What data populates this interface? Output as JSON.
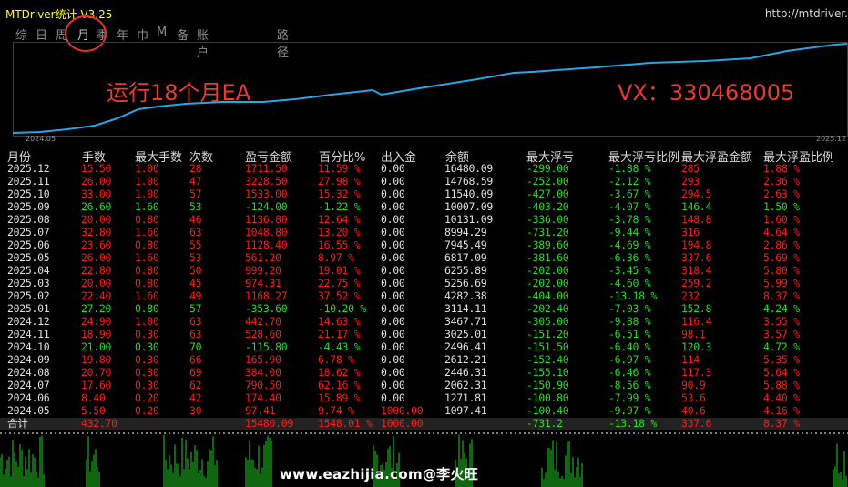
{
  "title": "MTDriver统计  V3.25",
  "url": "http://mtdriver.",
  "tabs": [
    "综",
    "日",
    "周",
    "月",
    "季",
    "年",
    "巾",
    "M",
    "备",
    "账户",
    "路径"
  ],
  "annotation_left": "运行18个月EA",
  "annotation_right": "VX：330468005",
  "date_start": "2024.05",
  "date_end": "2025.12",
  "headers": [
    "月份",
    "手数",
    "最大手数",
    "次数",
    "盈亏金额",
    "百分比%",
    "出入金",
    "余额",
    "最大浮亏",
    "最大浮亏比例",
    "最大浮盈金额",
    "最大浮盈比例"
  ],
  "rows": [
    [
      "2025.12",
      "15.50",
      "1.00",
      "28",
      "1711.50",
      "11.59 %",
      "0.00",
      "16480.09",
      "-299.00",
      "-1.88 %",
      "285",
      "1.88 %"
    ],
    [
      "2025.11",
      "26.00",
      "1.00",
      "47",
      "3228.50",
      "27.98 %",
      "0.00",
      "14768.59",
      "-252.00",
      "-2.12 %",
      "293",
      "2.36 %"
    ],
    [
      "2025.10",
      "33.00",
      "1.00",
      "57",
      "1533.00",
      "15.32 %",
      "0.00",
      "11540.09",
      "-427.00",
      "-3.67 %",
      "294.5",
      "2.63 %"
    ],
    [
      "2025.09",
      "26.60",
      "1.60",
      "53",
      "-124.00",
      "-1.22 %",
      "0.00",
      "10007.09",
      "-403.20",
      "-4.07 %",
      "146.4",
      "1.50 %"
    ],
    [
      "2025.08",
      "20.00",
      "0.80",
      "46",
      "1136.80",
      "12.64 %",
      "0.00",
      "10131.09",
      "-336.00",
      "-3.78 %",
      "148.8",
      "1.60 %"
    ],
    [
      "2025.07",
      "32.80",
      "1.60",
      "63",
      "1048.80",
      "13.20 %",
      "0.00",
      "8994.29",
      "-731.20",
      "-9.44 %",
      "316",
      "4.64 %"
    ],
    [
      "2025.06",
      "23.60",
      "0.80",
      "55",
      "1128.40",
      "16.55 %",
      "0.00",
      "7945.49",
      "-389.60",
      "-4.69 %",
      "194.8",
      "2.86 %"
    ],
    [
      "2025.05",
      "26.00",
      "1.60",
      "53",
      "561.20",
      "8.97 %",
      "0.00",
      "6817.09",
      "-381.60",
      "-6.36 %",
      "337.6",
      "5.69 %"
    ],
    [
      "2025.04",
      "22.80",
      "0.80",
      "50",
      "999.20",
      "19.01 %",
      "0.00",
      "6255.89",
      "-202.00",
      "-3.45 %",
      "318.4",
      "5.80 %"
    ],
    [
      "2025.03",
      "20.00",
      "0.80",
      "45",
      "974.31",
      "22.75 %",
      "0.00",
      "5256.69",
      "-202.00",
      "-4.60 %",
      "259.2",
      "5.99 %"
    ],
    [
      "2025.02",
      "22.40",
      "1.60",
      "49",
      "1168.27",
      "37.52 %",
      "0.00",
      "4282.38",
      "-404.00",
      "-13.18 %",
      "232",
      "8.37 %"
    ],
    [
      "2025.01",
      "27.20",
      "0.80",
      "57",
      "-353.60",
      "-10.20 %",
      "0.00",
      "3114.11",
      "-202.40",
      "-7.03 %",
      "152.8",
      "4.24 %"
    ],
    [
      "2024.12",
      "24.90",
      "1.00",
      "63",
      "442.70",
      "14.63 %",
      "0.00",
      "3467.71",
      "-305.00",
      "-9.88 %",
      "116.4",
      "3.55 %"
    ],
    [
      "2024.11",
      "18.90",
      "0.30",
      "63",
      "528.60",
      "21.17 %",
      "0.00",
      "3025.01",
      "-151.20",
      "-6.51 %",
      "98.1",
      "3.57 %"
    ],
    [
      "2024.10",
      "21.00",
      "0.30",
      "70",
      "-115.80",
      "-4.43 %",
      "0.00",
      "2496.41",
      "-151.50",
      "-6.40 %",
      "120.3",
      "4.72 %"
    ],
    [
      "2024.09",
      "19.80",
      "0.30",
      "66",
      "165.90",
      "6.78 %",
      "0.00",
      "2612.21",
      "-152.40",
      "-6.97 %",
      "114",
      "5.35 %"
    ],
    [
      "2024.08",
      "20.70",
      "0.30",
      "69",
      "384.00",
      "18.62 %",
      "0.00",
      "2446.31",
      "-155.10",
      "-6.46 %",
      "117.3",
      "5.64 %"
    ],
    [
      "2024.07",
      "17.60",
      "0.30",
      "62",
      "790.50",
      "62.16 %",
      "0.00",
      "2062.31",
      "-150.90",
      "-8.56 %",
      "90.9",
      "5.88 %"
    ],
    [
      "2024.06",
      "8.40",
      "0.20",
      "42",
      "174.40",
      "15.89 %",
      "0.00",
      "1271.81",
      "-100.80",
      "-7.99 %",
      "53.6",
      "4.40 %"
    ],
    [
      "2024.05",
      "5.50",
      "0.20",
      "30",
      "97.41",
      "9.74 %",
      "1000.00",
      "1097.41",
      "-100.40",
      "-9.97 %",
      "40.6",
      "4.16 %"
    ]
  ],
  "total": [
    "合计",
    "432.70",
    "",
    "",
    "15480.09",
    "1548.01 %",
    "1000.00",
    "",
    "-731.2",
    "-13.18 %",
    "337.6",
    "8.37 %"
  ],
  "watermark": "www.eazhijia.com@李火旺",
  "colors": {
    "profit": "#ff1a1a",
    "loss": "#22dd22",
    "title": "#ffff00",
    "curve": "#2aa4e6",
    "annotation": "#e83b35"
  }
}
